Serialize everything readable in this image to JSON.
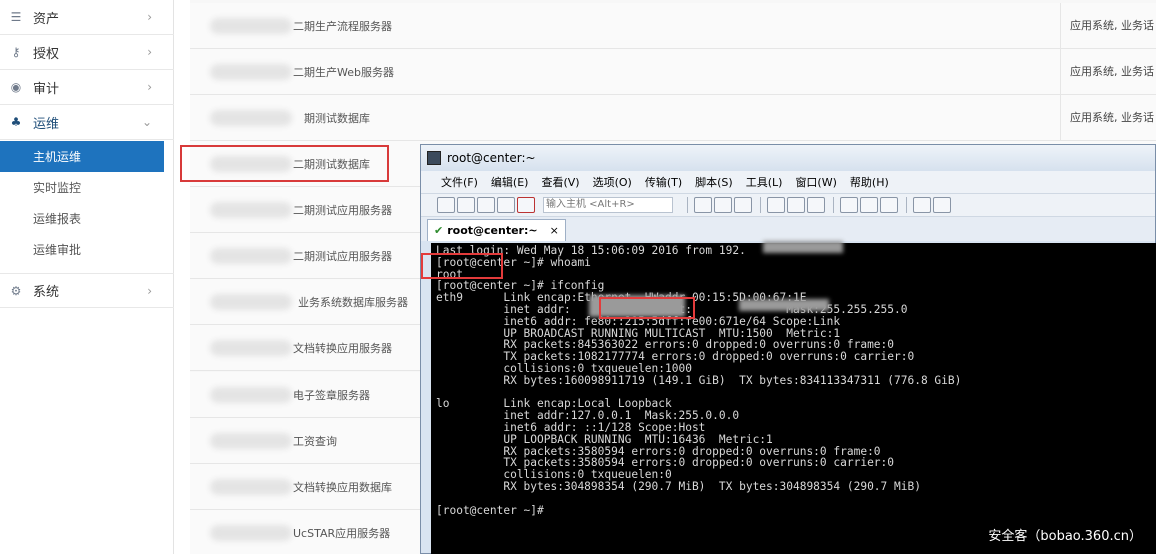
{
  "sidebar": {
    "items": [
      {
        "label": "资产",
        "icon": "list-icon",
        "chevron": "›"
      },
      {
        "label": "授权",
        "icon": "key-icon",
        "chevron": "›"
      },
      {
        "label": "审计",
        "icon": "eye-icon",
        "chevron": "›"
      },
      {
        "label": "运维",
        "icon": "sitemap-icon",
        "chevron": "⌄"
      },
      {
        "label": "系统",
        "icon": "gear-icon",
        "chevron": "›"
      }
    ],
    "subitems": [
      "主机运维",
      "实时监控",
      "运维报表",
      "运维审批"
    ]
  },
  "hosts": {
    "rows": [
      {
        "name": "二期生产流程服务器",
        "category": "应用系统, 业务话"
      },
      {
        "name": "二期生产Web服务器",
        "category": "应用系统, 业务话"
      },
      {
        "name": "期测试数据库",
        "category": "应用系统, 业务话"
      },
      {
        "name": "二期测试数据库",
        "category": ""
      },
      {
        "name": "二期测试应用服务器",
        "category": ""
      },
      {
        "name": "二期测试应用服务器",
        "category": ""
      },
      {
        "name": "业务系统数据库服务器",
        "category": ""
      },
      {
        "name": "文档转换应用服务器",
        "category": ""
      },
      {
        "name": "电子签章服务器",
        "category": ""
      },
      {
        "name": "工资查询",
        "category": ""
      },
      {
        "name": "文档转换应用数据库",
        "category": ""
      },
      {
        "name": "UcSTAR应用服务器",
        "category": ""
      }
    ]
  },
  "terminal": {
    "title": "root@center:~",
    "menu": [
      "文件(F)",
      "编辑(E)",
      "查看(V)",
      "选项(O)",
      "传输(T)",
      "脚本(S)",
      "工具(L)",
      "窗口(W)",
      "帮助(H)"
    ],
    "host_input_placeholder": "输入主机 <Alt+R>",
    "tab_label": "root@center:~",
    "tab_close": "×",
    "output": "Last login: Wed May 18 15:06:09 2016 from 192.\n[root@center ~]# whoami\nroot\n[root@center ~]# ifconfig\neth9      Link encap:Ethernet  HWaddr 00:15:5D:00:67:1E\n          inet addr:            Bcast:              Mask:255.255.255.0\n          inet6 addr: fe80::215:5dff:fe00:671e/64 Scope:Link\n          UP BROADCAST RUNNING MULTICAST  MTU:1500  Metric:1\n          RX packets:845363022 errors:0 dropped:0 overruns:0 frame:0\n          TX packets:1082177774 errors:0 dropped:0 overruns:0 carrier:0\n          collisions:0 txqueuelen:1000\n          RX bytes:160098911719 (149.1 GiB)  TX bytes:834113347311 (776.8 GiB)\n\nlo        Link encap:Local Loopback\n          inet addr:127.0.0.1  Mask:255.0.0.0\n          inet6 addr: ::1/128 Scope:Host\n          UP LOOPBACK RUNNING  MTU:16436  Metric:1\n          RX packets:3580594 errors:0 dropped:0 overruns:0 frame:0\n          TX packets:3580594 errors:0 dropped:0 overruns:0 carrier:0\n          collisions:0 txqueuelen:0\n          RX bytes:304898354 (290.7 MiB)  TX bytes:304898354 (290.7 MiB)\n\n[root@center ~]#"
  },
  "watermark": "安全客（bobao.360.cn）"
}
